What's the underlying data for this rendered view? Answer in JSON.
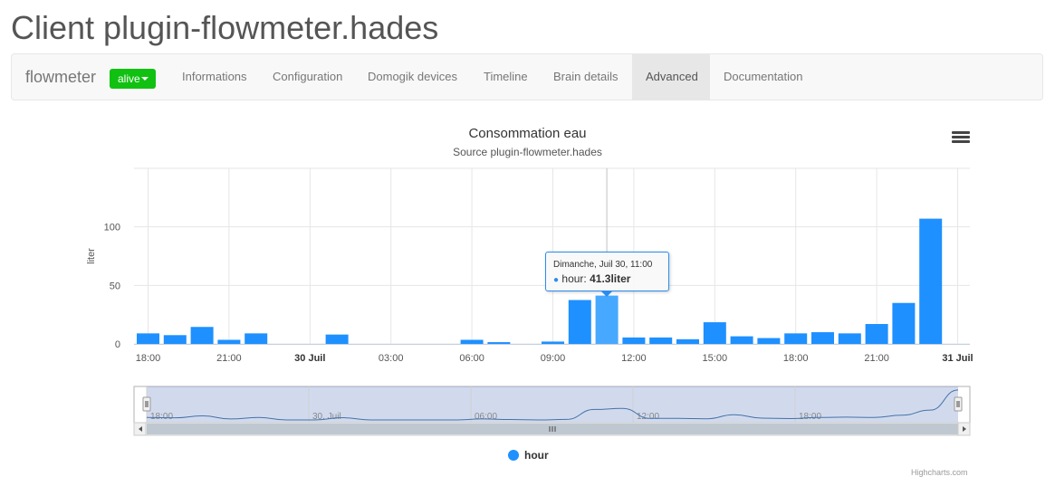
{
  "page": {
    "title": "Client plugin-flowmeter.hades"
  },
  "navbar": {
    "brand": "flowmeter",
    "status": {
      "label": "alive",
      "color": "#11c111"
    },
    "tabs": [
      {
        "label": "Informations",
        "active": false
      },
      {
        "label": "Configuration",
        "active": false
      },
      {
        "label": "Domogik devices",
        "active": false
      },
      {
        "label": "Timeline",
        "active": false
      },
      {
        "label": "Brain details",
        "active": false
      },
      {
        "label": "Advanced",
        "active": true
      },
      {
        "label": "Documentation",
        "active": false
      }
    ]
  },
  "chart_menu_icon": "menu-icon",
  "tooltip": {
    "date": "Dimanche, Juil 30, 11:00",
    "series": "hour",
    "value": "41.3liter"
  },
  "legend": {
    "label": "hour",
    "color": "#1e90ff"
  },
  "credits": "Highcharts.com",
  "chart_data": {
    "type": "bar",
    "title": "Consommation eau",
    "subtitle": "Source plugin-flowmeter.hades",
    "xlabel": "",
    "ylabel": "liter",
    "ylim": [
      0,
      150
    ],
    "y_ticks": [
      0,
      50,
      100
    ],
    "grid": true,
    "legend_position": "bottom-center",
    "color": "#1e90ff",
    "highlight_color": "#47a8ff",
    "x_ticks": [
      "18:00",
      "21:00",
      "30 Juil",
      "03:00",
      "06:00",
      "09:00",
      "12:00",
      "15:00",
      "18:00",
      "21:00",
      "31 Juil"
    ],
    "x_ticks_bold": [
      "30 Juil",
      "31 Juil"
    ],
    "series": [
      {
        "name": "hour",
        "x": [
          "18:00",
          "19:00",
          "20:00",
          "21:00",
          "22:00",
          "23:00",
          "00:00",
          "01:00",
          "02:00",
          "03:00",
          "04:00",
          "05:00",
          "06:00",
          "07:00",
          "08:00",
          "09:00",
          "10:00",
          "11:00",
          "12:00",
          "13:00",
          "14:00",
          "15:00",
          "16:00",
          "17:00",
          "18:00",
          "19:00",
          "20:00",
          "21:00",
          "22:00",
          "23:00"
        ],
        "values": [
          9,
          7.5,
          14.5,
          3.5,
          9,
          0,
          0,
          8,
          0,
          0,
          0,
          0,
          3.5,
          1.5,
          0,
          2,
          37.5,
          41.3,
          5.5,
          5.5,
          4,
          18.5,
          6.5,
          5,
          9,
          10,
          9,
          17,
          35,
          107
        ]
      }
    ],
    "highlighted_point": "11:00",
    "navigator": {
      "labels": [
        "18:00",
        "30. Juil",
        "06:00",
        "12:00",
        "18:00"
      ]
    }
  }
}
